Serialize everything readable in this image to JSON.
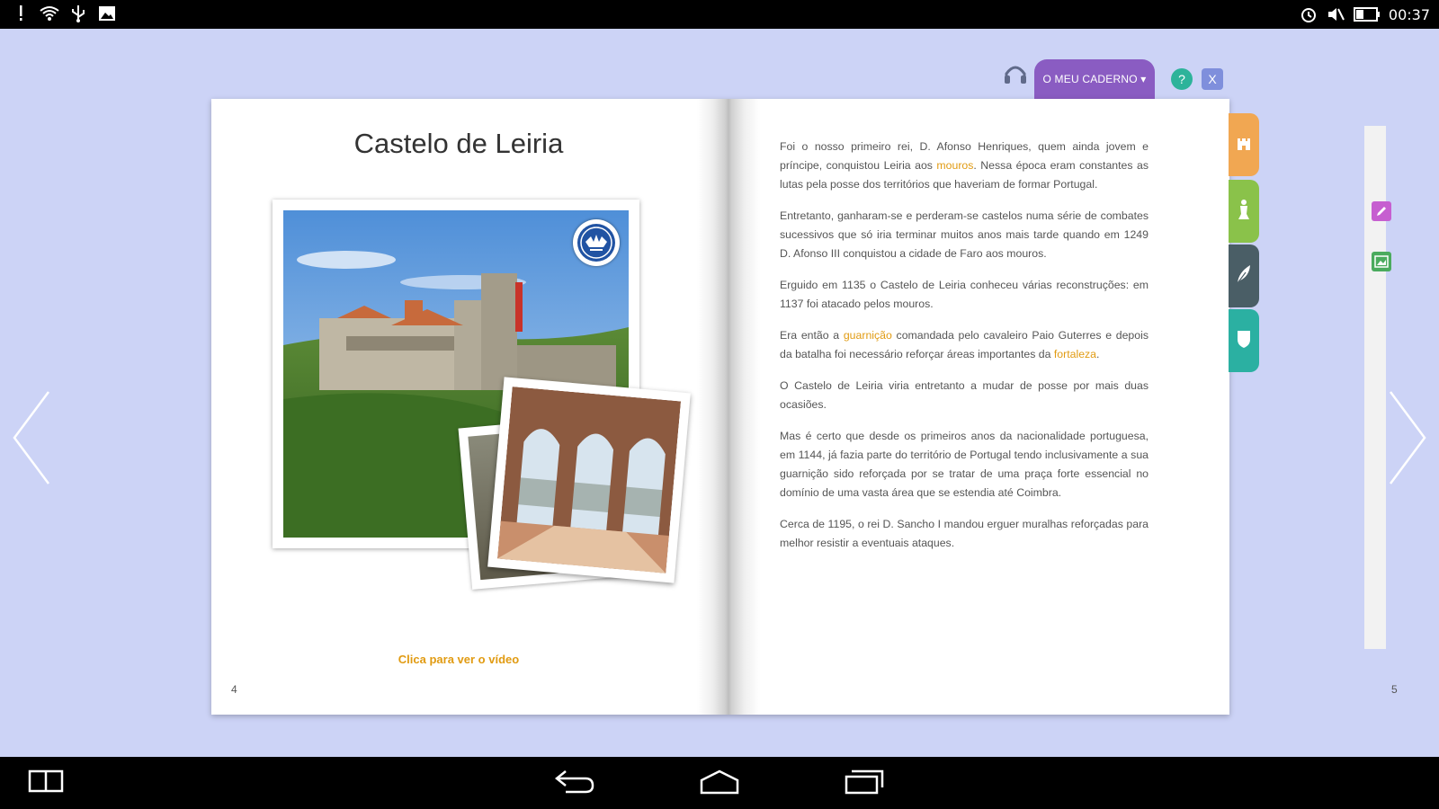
{
  "status_bar": {
    "time": "00:37",
    "left_icons": [
      "notification-icon",
      "wifi-icon",
      "usb-icon",
      "image-icon"
    ],
    "right_icons": [
      "alarm-icon",
      "mute-icon",
      "battery-icon"
    ]
  },
  "toolbar": {
    "notebook_label": "O MEU CADERNO ▾",
    "help_label": "?",
    "close_label": "X"
  },
  "book": {
    "left_page": {
      "title": "Castelo de Leiria",
      "video_link": "Clica para ver o vídeo",
      "page_number": "4"
    },
    "right_page": {
      "page_number": "5",
      "p1_a": "Foi o nosso primeiro rei, D. Afonso Henriques, quem ainda jovem e príncipe, conquistou Leiria aos ",
      "p1_hl": "mouros",
      "p1_b": ". Nessa época eram constantes as lutas pela posse dos territórios que haveriam de formar Portugal.",
      "p2": "Entretanto, ganharam-se e perderam-se castelos numa série de combates sucessivos que só iria terminar muitos anos mais tarde quando em 1249 D. Afonso III conquistou a cidade de Faro aos mouros.",
      "p3": "Erguido em 1135 o Castelo de Leiria conheceu várias reconstruções: em 1137 foi atacado pelos mouros.",
      "p4_a": "Era então a ",
      "p4_hl1": "guarnição",
      "p4_b": " comandada pelo cavaleiro Paio Guterres e depois da batalha foi necessário reforçar áreas importantes da ",
      "p4_hl2": "fortaleza",
      "p4_c": ".",
      "p5": "O Castelo de Leiria viria entretanto a mudar de posse por mais duas ocasiões.",
      "p6": "Mas é certo que desde os primeiros anos da nacionalidade portuguesa, em 1144, já fazia parte do território de Portugal tendo inclusivamente a sua guarnição sido reforçada por se tratar de uma praça forte essencial no domínio de uma vasta área que se estendia até Coimbra.",
      "p7": "Cerca de 1195, o rei D. Sancho I mandou erguer muralhas reforçadas para melhor resistir a eventuais ataques."
    }
  },
  "side_tabs": [
    "castle-icon",
    "king-icon",
    "feather-icon",
    "shield-icon"
  ],
  "colors": {
    "background": "#ccd3f6",
    "notebook_tab": "#8a5cc2",
    "highlight": "#e19b12",
    "tab_orange": "#f1a752",
    "tab_green": "#8ac24a",
    "tab_dark": "#4a5e66",
    "tab_teal": "#2bb0a2"
  }
}
